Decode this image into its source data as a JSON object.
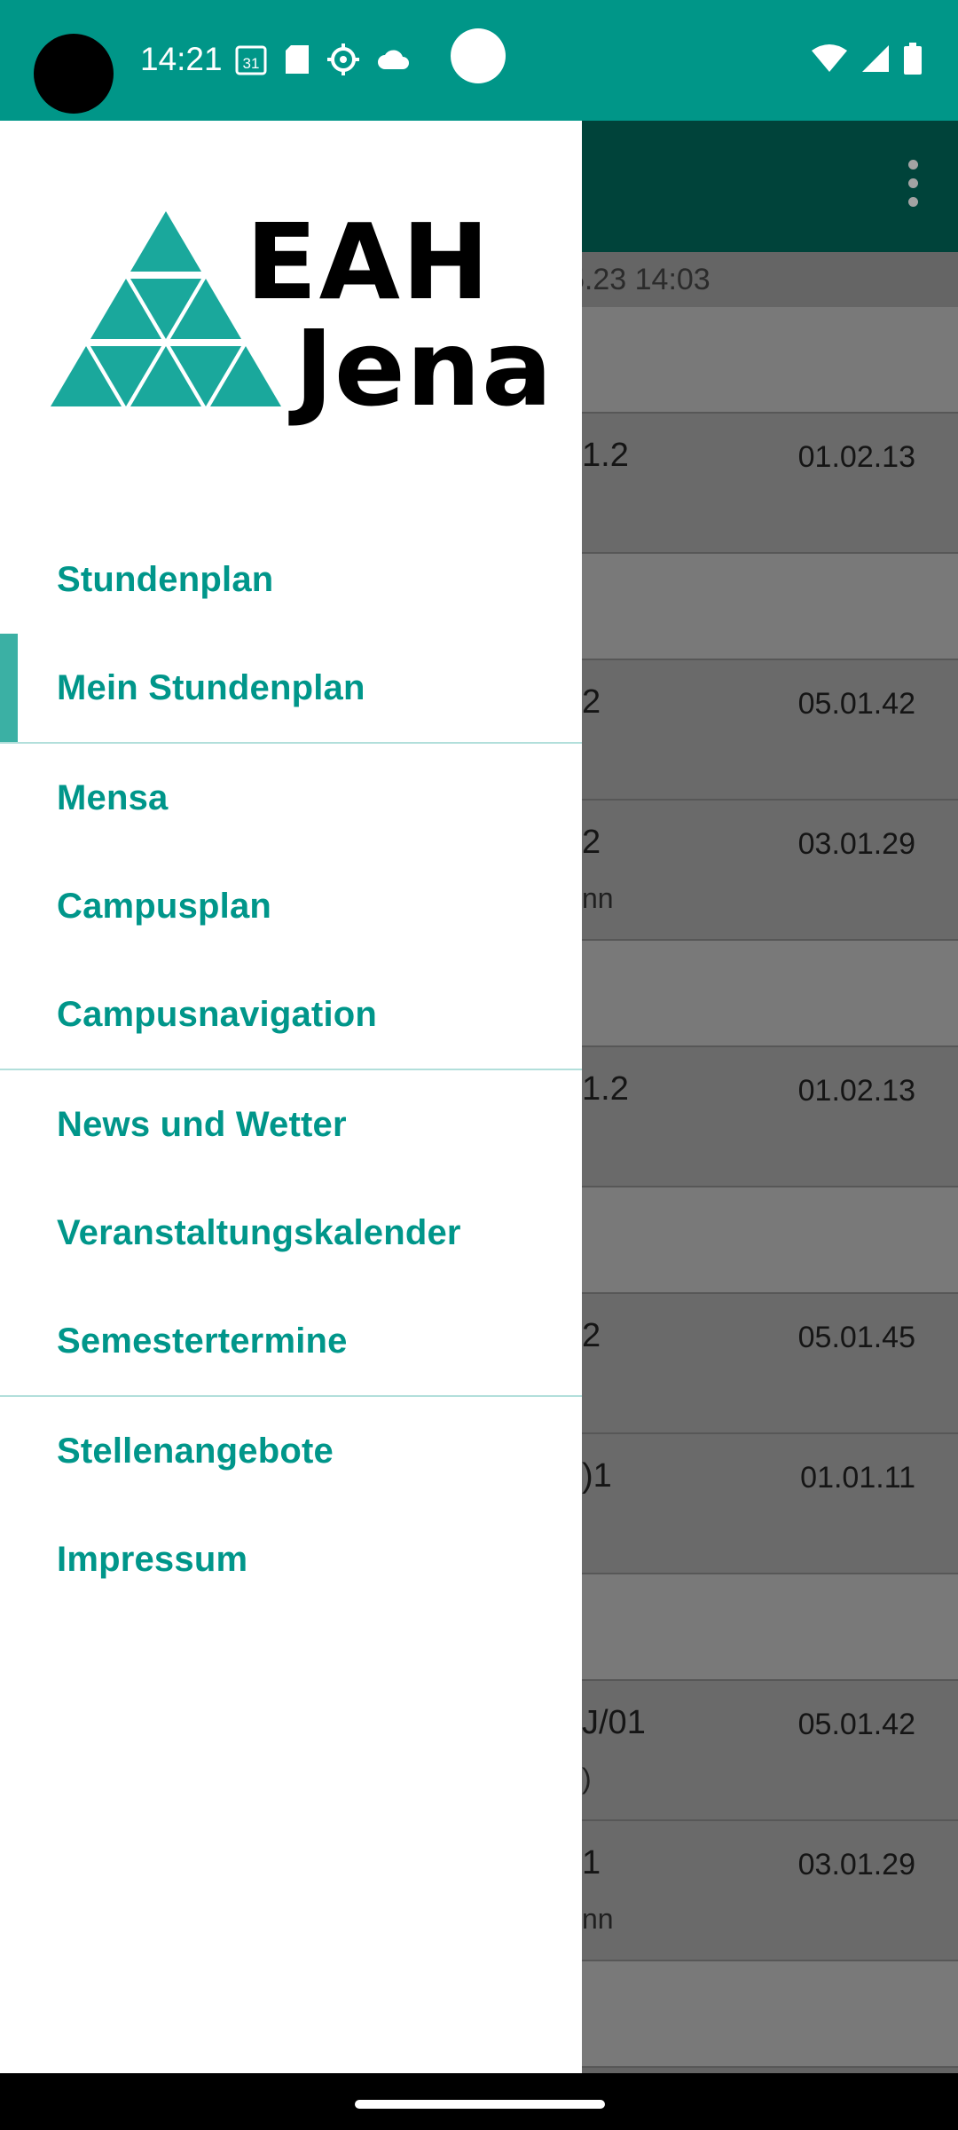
{
  "status_bar": {
    "time": "14:21",
    "calendar_day": "31",
    "bg_color": "#009688"
  },
  "background_app": {
    "updated_stamp": "5.23 14:03",
    "rows": [
      {
        "type": "header"
      },
      {
        "left": "1.2",
        "sub": "",
        "right": "01.02.13"
      },
      {
        "type": "header"
      },
      {
        "left": "2",
        "sub": "",
        "right": "05.01.42"
      },
      {
        "left": "2",
        "sub": "nn",
        "right": "03.01.29"
      },
      {
        "type": "header"
      },
      {
        "left": "1.2",
        "sub": "",
        "right": "01.02.13"
      },
      {
        "type": "header"
      },
      {
        "left": "2",
        "sub": "",
        "right": "05.01.45"
      },
      {
        "left": ")1",
        "sub": "",
        "right": "01.01.11"
      },
      {
        "type": "header"
      },
      {
        "left": "J/01",
        "sub": ")",
        "right": "05.01.42"
      },
      {
        "left": "1",
        "sub": "nn",
        "right": "03.01.29"
      },
      {
        "type": "header"
      }
    ]
  },
  "drawer": {
    "logo": {
      "line1": "EAH",
      "line2": "Jena",
      "accent": "#1aa89c"
    },
    "menu_groups": [
      [
        {
          "label": "Stundenplan",
          "name": "menu-stundenplan"
        },
        {
          "label": "Mein Stundenplan",
          "name": "menu-mein-stundenplan",
          "active": true
        }
      ],
      [
        {
          "label": "Mensa",
          "name": "menu-mensa"
        },
        {
          "label": "Campusplan",
          "name": "menu-campusplan"
        },
        {
          "label": "Campusnavigation",
          "name": "menu-campusnavigation"
        }
      ],
      [
        {
          "label": "News und Wetter",
          "name": "menu-news-und-wetter"
        },
        {
          "label": "Veranstaltungskalender",
          "name": "menu-veranstaltungskalender"
        },
        {
          "label": "Semestertermine",
          "name": "menu-semestertermine"
        }
      ],
      [
        {
          "label": "Stellenangebote",
          "name": "menu-stellenangebote"
        },
        {
          "label": "Impressum",
          "name": "menu-impressum"
        }
      ]
    ],
    "text_color": "#00968a"
  }
}
